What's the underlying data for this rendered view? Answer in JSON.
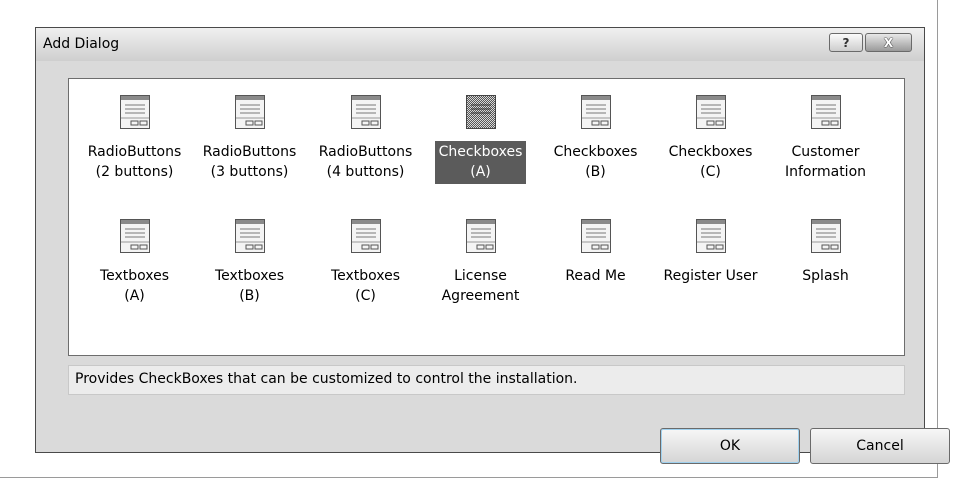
{
  "dialog": {
    "title": "Add Dialog",
    "help_button": "?",
    "close_button": "X",
    "description": "Provides CheckBoxes that can be customized to control the installation.",
    "ok_label": "OK",
    "cancel_label": "Cancel"
  },
  "templates": [
    {
      "label": "RadioButtons\n(2 buttons)",
      "icon": "dialog-template-icon",
      "selected": false
    },
    {
      "label": "RadioButtons\n(3 buttons)",
      "icon": "dialog-template-icon",
      "selected": false
    },
    {
      "label": "RadioButtons\n(4 buttons)",
      "icon": "dialog-template-icon",
      "selected": false
    },
    {
      "label": "Checkboxes\n(A)",
      "icon": "dialog-template-icon",
      "selected": true
    },
    {
      "label": "Checkboxes\n(B)",
      "icon": "dialog-template-icon",
      "selected": false
    },
    {
      "label": "Checkboxes\n(C)",
      "icon": "dialog-template-icon",
      "selected": false
    },
    {
      "label": "Customer\nInformation",
      "icon": "dialog-template-icon",
      "selected": false
    },
    {
      "label": "Textboxes\n(A)",
      "icon": "dialog-template-icon",
      "selected": false
    },
    {
      "label": "Textboxes\n(B)",
      "icon": "dialog-template-icon",
      "selected": false
    },
    {
      "label": "Textboxes\n(C)",
      "icon": "dialog-template-icon",
      "selected": false
    },
    {
      "label": "License\nAgreement",
      "icon": "dialog-template-icon",
      "selected": false
    },
    {
      "label": "Read Me",
      "icon": "dialog-template-icon",
      "selected": false
    },
    {
      "label": "Register User",
      "icon": "dialog-template-icon",
      "selected": false
    },
    {
      "label": "Splash",
      "icon": "dialog-template-icon",
      "selected": false
    }
  ],
  "colors": {
    "selection": "#5b5b5b",
    "dialog_background": "#dadada"
  }
}
